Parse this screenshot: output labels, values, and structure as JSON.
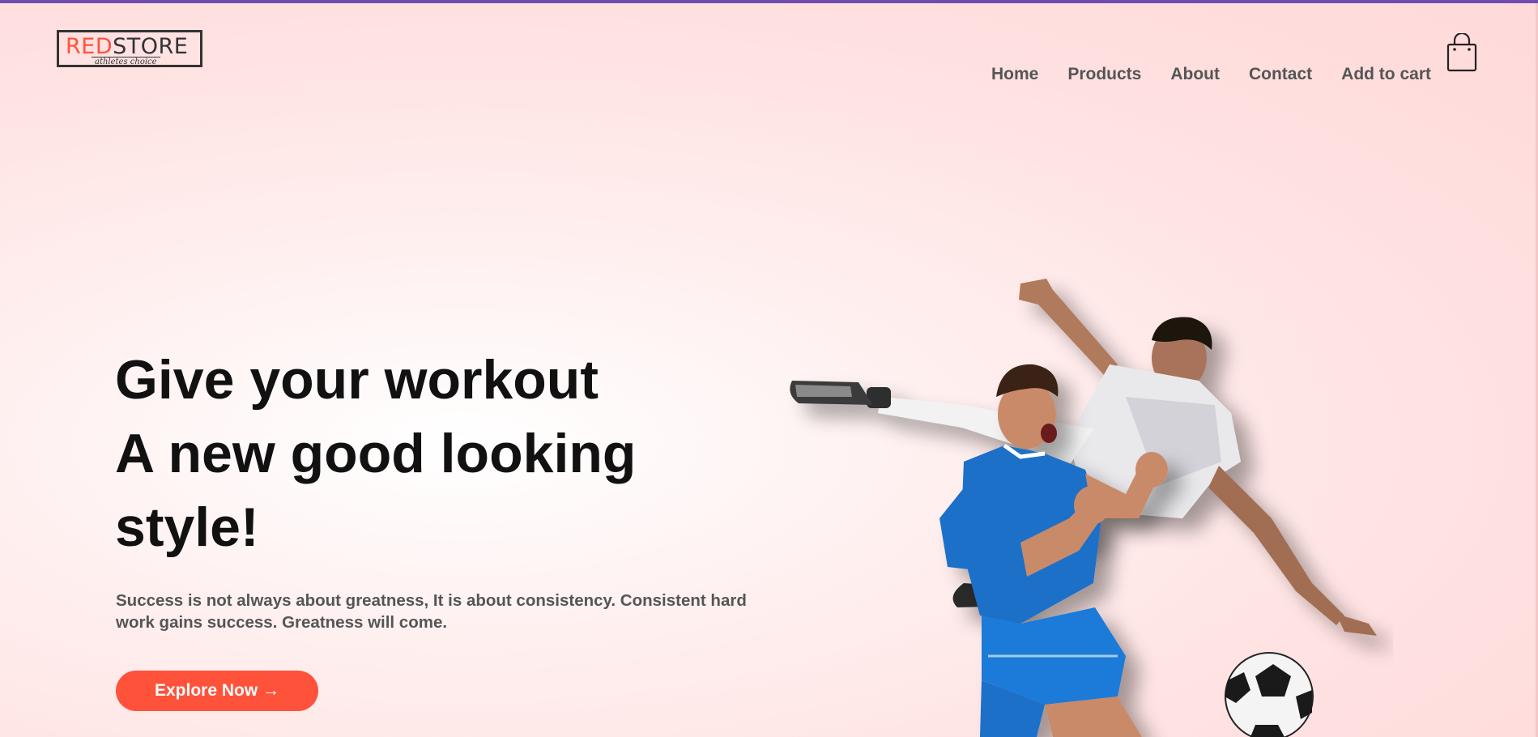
{
  "header": {
    "logo": {
      "word_red": "RED",
      "word_dark": "STORE",
      "tagline": "athletes choice"
    },
    "nav": [
      {
        "label": "Home"
      },
      {
        "label": "Products"
      },
      {
        "label": "About"
      },
      {
        "label": "Contact"
      },
      {
        "label": "Add to cart"
      }
    ],
    "cart_icon": "shopping-bag-icon"
  },
  "hero": {
    "title_lines": [
      "Give your workout",
      "A new good looking",
      "style!"
    ],
    "description": "Success is not always about greatness, It is about consistency. Consistent hard work gains success. Greatness will come.",
    "cta_label": "Explore Now →",
    "image": "soccer-players-illustration"
  },
  "colors": {
    "accent": "#ff523b",
    "top_bar": "#6f4cb0",
    "text_dark": "#111111",
    "text_muted": "#555555"
  }
}
